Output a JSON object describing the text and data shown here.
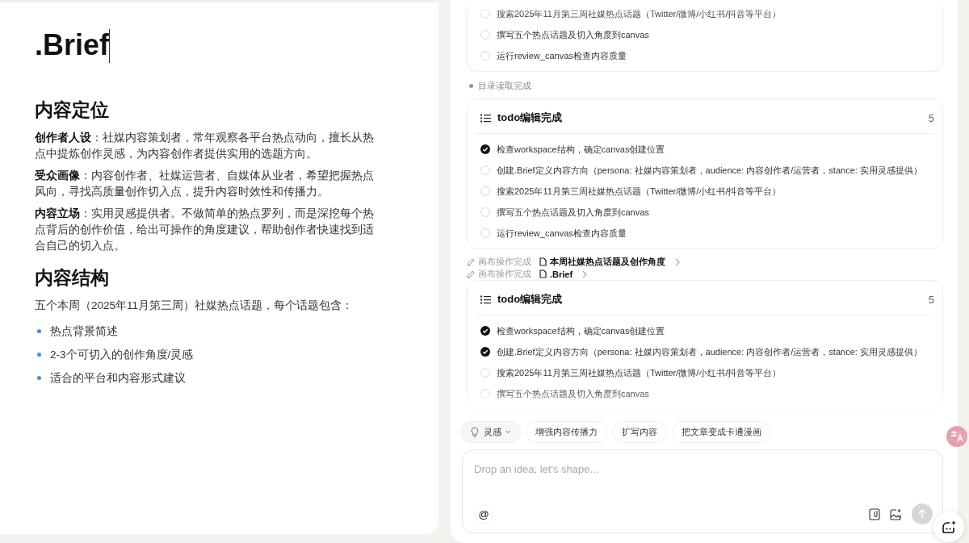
{
  "document": {
    "title": ".Brief",
    "sections": [
      {
        "heading": "内容定位",
        "paragraphs": [
          "**创作者人设**：社媒内容策划者，常年观察各平台热点动向，擅长从热点中提炼创作灵感，为内容创作者提供实用的选题方向。",
          "**受众画像**：内容创作者、社媒运营者、自媒体从业者，希望把握热点风向，寻找高质量创作切入点，提升内容时效性和传播力。",
          "**内容立场**：实用灵感提供者。不做简单的热点罗列，而是深挖每个热点背后的创作价值，给出可操作的角度建议，帮助创作者快速找到适合自己的切入点。"
        ]
      },
      {
        "heading": "内容结构",
        "paragraphs": [
          "五个本周（2025年11月第三周）社媒热点话题，每个话题包含："
        ],
        "bullets": [
          "热点背景简述",
          "2-3个可切入的创作角度/灵感",
          "适合的平台和内容形式建议"
        ]
      }
    ]
  },
  "chat": {
    "messages": [
      {
        "kind": "todo",
        "items": [
          {
            "text": "搜索2025年11月第三周社媒热点话题（Twitter/微博/小红书/抖音等平台）",
            "checked": false
          },
          {
            "text": "撰写五个热点话题及切入角度到canvas",
            "checked": false
          },
          {
            "text": "运行review_canvas检查内容质量",
            "checked": false
          }
        ]
      },
      {
        "kind": "status",
        "text": "目录读取完成"
      },
      {
        "kind": "todo",
        "title": "todo编辑完成",
        "count": "5",
        "items": [
          {
            "text": "检查workspace结构，确定canvas创建位置",
            "checked": true
          },
          {
            "text": "创建.Brief定义内容方向（persona: 社媒内容策划者，audience: 内容创作者/运营者，stance: 实用灵感提供）",
            "checked": false
          },
          {
            "text": "搜索2025年11月第三周社媒热点话题（Twitter/微博/小红书/抖音等平台）",
            "checked": false
          },
          {
            "text": "撰写五个热点话题及切入角度到canvas",
            "checked": false
          },
          {
            "text": "运行review_canvas检查内容质量",
            "checked": false
          }
        ]
      },
      {
        "kind": "canvas_op",
        "text": "画布操作完成",
        "file": "本周社媒热点话题及创作角度"
      },
      {
        "kind": "canvas_op",
        "text": "画布操作完成",
        "file": ".Brief"
      },
      {
        "kind": "todo",
        "title": "todo编辑完成",
        "count": "5",
        "items": [
          {
            "text": "检查workspace结构，确定canvas创建位置",
            "checked": true
          },
          {
            "text": "创建.Brief定义内容方向（persona: 社媒内容策划者，audience: 内容创作者/运营者，stance: 实用灵感提供）",
            "checked": true
          },
          {
            "text": "搜索2025年11月第三周社媒热点话题（Twitter/微博/小红书/抖音等平台）",
            "checked": false
          },
          {
            "text": "撰写五个热点话题及切入角度到canvas",
            "checked": false
          }
        ]
      }
    ]
  },
  "suggestions": [
    {
      "kind": "dropdown",
      "label": "灵感"
    },
    {
      "kind": "chip",
      "label": "增强内容传播力"
    },
    {
      "kind": "chip",
      "label": "扩写内容"
    },
    {
      "kind": "chip",
      "label": "把文章变成卡通漫画"
    }
  ],
  "composer": {
    "placeholder": "Drop an idea, let's shape...",
    "mention": "@"
  }
}
